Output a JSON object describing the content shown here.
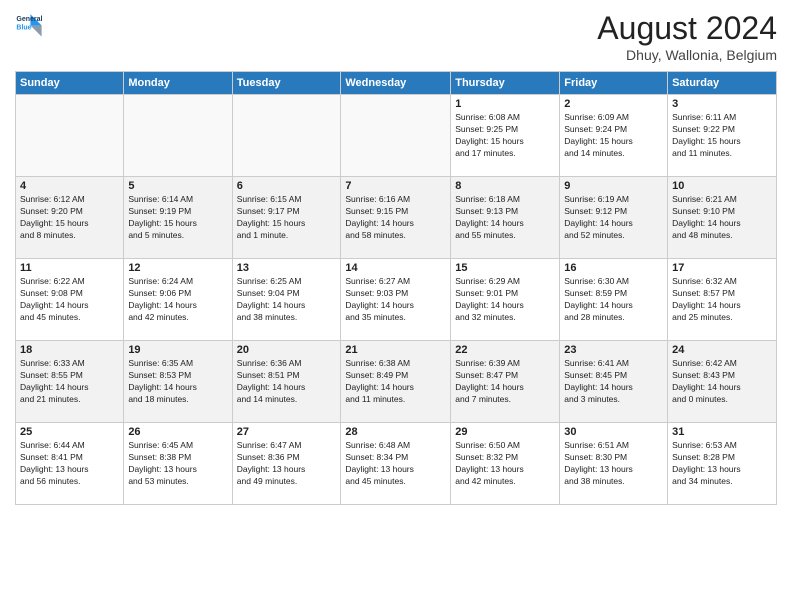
{
  "header": {
    "logo_line1": "General",
    "logo_line2": "Blue",
    "month_year": "August 2024",
    "location": "Dhuy, Wallonia, Belgium"
  },
  "weekdays": [
    "Sunday",
    "Monday",
    "Tuesday",
    "Wednesday",
    "Thursday",
    "Friday",
    "Saturday"
  ],
  "weeks": [
    [
      {
        "day": "",
        "info": ""
      },
      {
        "day": "",
        "info": ""
      },
      {
        "day": "",
        "info": ""
      },
      {
        "day": "",
        "info": ""
      },
      {
        "day": "1",
        "info": "Sunrise: 6:08 AM\nSunset: 9:25 PM\nDaylight: 15 hours\nand 17 minutes."
      },
      {
        "day": "2",
        "info": "Sunrise: 6:09 AM\nSunset: 9:24 PM\nDaylight: 15 hours\nand 14 minutes."
      },
      {
        "day": "3",
        "info": "Sunrise: 6:11 AM\nSunset: 9:22 PM\nDaylight: 15 hours\nand 11 minutes."
      }
    ],
    [
      {
        "day": "4",
        "info": "Sunrise: 6:12 AM\nSunset: 9:20 PM\nDaylight: 15 hours\nand 8 minutes."
      },
      {
        "day": "5",
        "info": "Sunrise: 6:14 AM\nSunset: 9:19 PM\nDaylight: 15 hours\nand 5 minutes."
      },
      {
        "day": "6",
        "info": "Sunrise: 6:15 AM\nSunset: 9:17 PM\nDaylight: 15 hours\nand 1 minute."
      },
      {
        "day": "7",
        "info": "Sunrise: 6:16 AM\nSunset: 9:15 PM\nDaylight: 14 hours\nand 58 minutes."
      },
      {
        "day": "8",
        "info": "Sunrise: 6:18 AM\nSunset: 9:13 PM\nDaylight: 14 hours\nand 55 minutes."
      },
      {
        "day": "9",
        "info": "Sunrise: 6:19 AM\nSunset: 9:12 PM\nDaylight: 14 hours\nand 52 minutes."
      },
      {
        "day": "10",
        "info": "Sunrise: 6:21 AM\nSunset: 9:10 PM\nDaylight: 14 hours\nand 48 minutes."
      }
    ],
    [
      {
        "day": "11",
        "info": "Sunrise: 6:22 AM\nSunset: 9:08 PM\nDaylight: 14 hours\nand 45 minutes."
      },
      {
        "day": "12",
        "info": "Sunrise: 6:24 AM\nSunset: 9:06 PM\nDaylight: 14 hours\nand 42 minutes."
      },
      {
        "day": "13",
        "info": "Sunrise: 6:25 AM\nSunset: 9:04 PM\nDaylight: 14 hours\nand 38 minutes."
      },
      {
        "day": "14",
        "info": "Sunrise: 6:27 AM\nSunset: 9:03 PM\nDaylight: 14 hours\nand 35 minutes."
      },
      {
        "day": "15",
        "info": "Sunrise: 6:29 AM\nSunset: 9:01 PM\nDaylight: 14 hours\nand 32 minutes."
      },
      {
        "day": "16",
        "info": "Sunrise: 6:30 AM\nSunset: 8:59 PM\nDaylight: 14 hours\nand 28 minutes."
      },
      {
        "day": "17",
        "info": "Sunrise: 6:32 AM\nSunset: 8:57 PM\nDaylight: 14 hours\nand 25 minutes."
      }
    ],
    [
      {
        "day": "18",
        "info": "Sunrise: 6:33 AM\nSunset: 8:55 PM\nDaylight: 14 hours\nand 21 minutes."
      },
      {
        "day": "19",
        "info": "Sunrise: 6:35 AM\nSunset: 8:53 PM\nDaylight: 14 hours\nand 18 minutes."
      },
      {
        "day": "20",
        "info": "Sunrise: 6:36 AM\nSunset: 8:51 PM\nDaylight: 14 hours\nand 14 minutes."
      },
      {
        "day": "21",
        "info": "Sunrise: 6:38 AM\nSunset: 8:49 PM\nDaylight: 14 hours\nand 11 minutes."
      },
      {
        "day": "22",
        "info": "Sunrise: 6:39 AM\nSunset: 8:47 PM\nDaylight: 14 hours\nand 7 minutes."
      },
      {
        "day": "23",
        "info": "Sunrise: 6:41 AM\nSunset: 8:45 PM\nDaylight: 14 hours\nand 3 minutes."
      },
      {
        "day": "24",
        "info": "Sunrise: 6:42 AM\nSunset: 8:43 PM\nDaylight: 14 hours\nand 0 minutes."
      }
    ],
    [
      {
        "day": "25",
        "info": "Sunrise: 6:44 AM\nSunset: 8:41 PM\nDaylight: 13 hours\nand 56 minutes."
      },
      {
        "day": "26",
        "info": "Sunrise: 6:45 AM\nSunset: 8:38 PM\nDaylight: 13 hours\nand 53 minutes."
      },
      {
        "day": "27",
        "info": "Sunrise: 6:47 AM\nSunset: 8:36 PM\nDaylight: 13 hours\nand 49 minutes."
      },
      {
        "day": "28",
        "info": "Sunrise: 6:48 AM\nSunset: 8:34 PM\nDaylight: 13 hours\nand 45 minutes."
      },
      {
        "day": "29",
        "info": "Sunrise: 6:50 AM\nSunset: 8:32 PM\nDaylight: 13 hours\nand 42 minutes."
      },
      {
        "day": "30",
        "info": "Sunrise: 6:51 AM\nSunset: 8:30 PM\nDaylight: 13 hours\nand 38 minutes."
      },
      {
        "day": "31",
        "info": "Sunrise: 6:53 AM\nSunset: 8:28 PM\nDaylight: 13 hours\nand 34 minutes."
      }
    ]
  ]
}
